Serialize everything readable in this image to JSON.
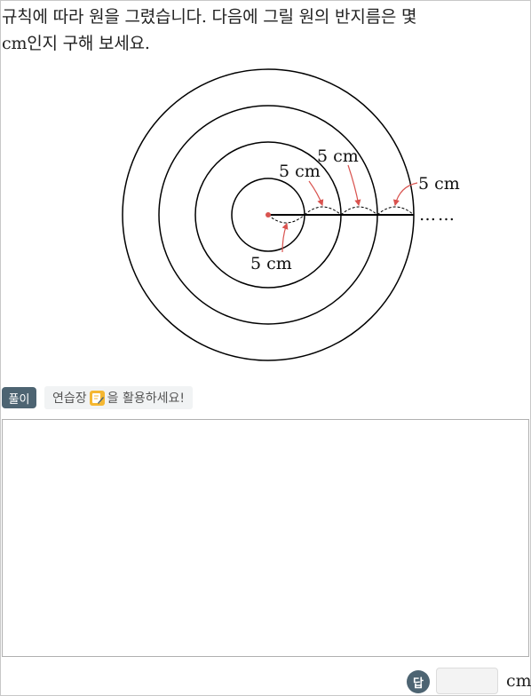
{
  "question": {
    "line1": "규칙에 따라 원을 그렸습니다. 다음에 그릴 원의 반지름은 몇",
    "line2": "cm인지 구해 보세요."
  },
  "figure": {
    "label_bottom": "5 cm",
    "label_first": "5 cm",
    "label_second": "5 cm",
    "label_third": "5 cm",
    "ellipsis": "……",
    "arrow_color": "#d9534f"
  },
  "solution": {
    "badge": "풀이",
    "hint_before": "연습장",
    "hint_after": "을 활용하세요!",
    "icon": "memo-pencil-icon"
  },
  "answer": {
    "badge": "답",
    "value": "",
    "unit": "cm"
  },
  "colors": {
    "badge_bg": "#4d6472",
    "memo_icon": "#f5b731"
  }
}
